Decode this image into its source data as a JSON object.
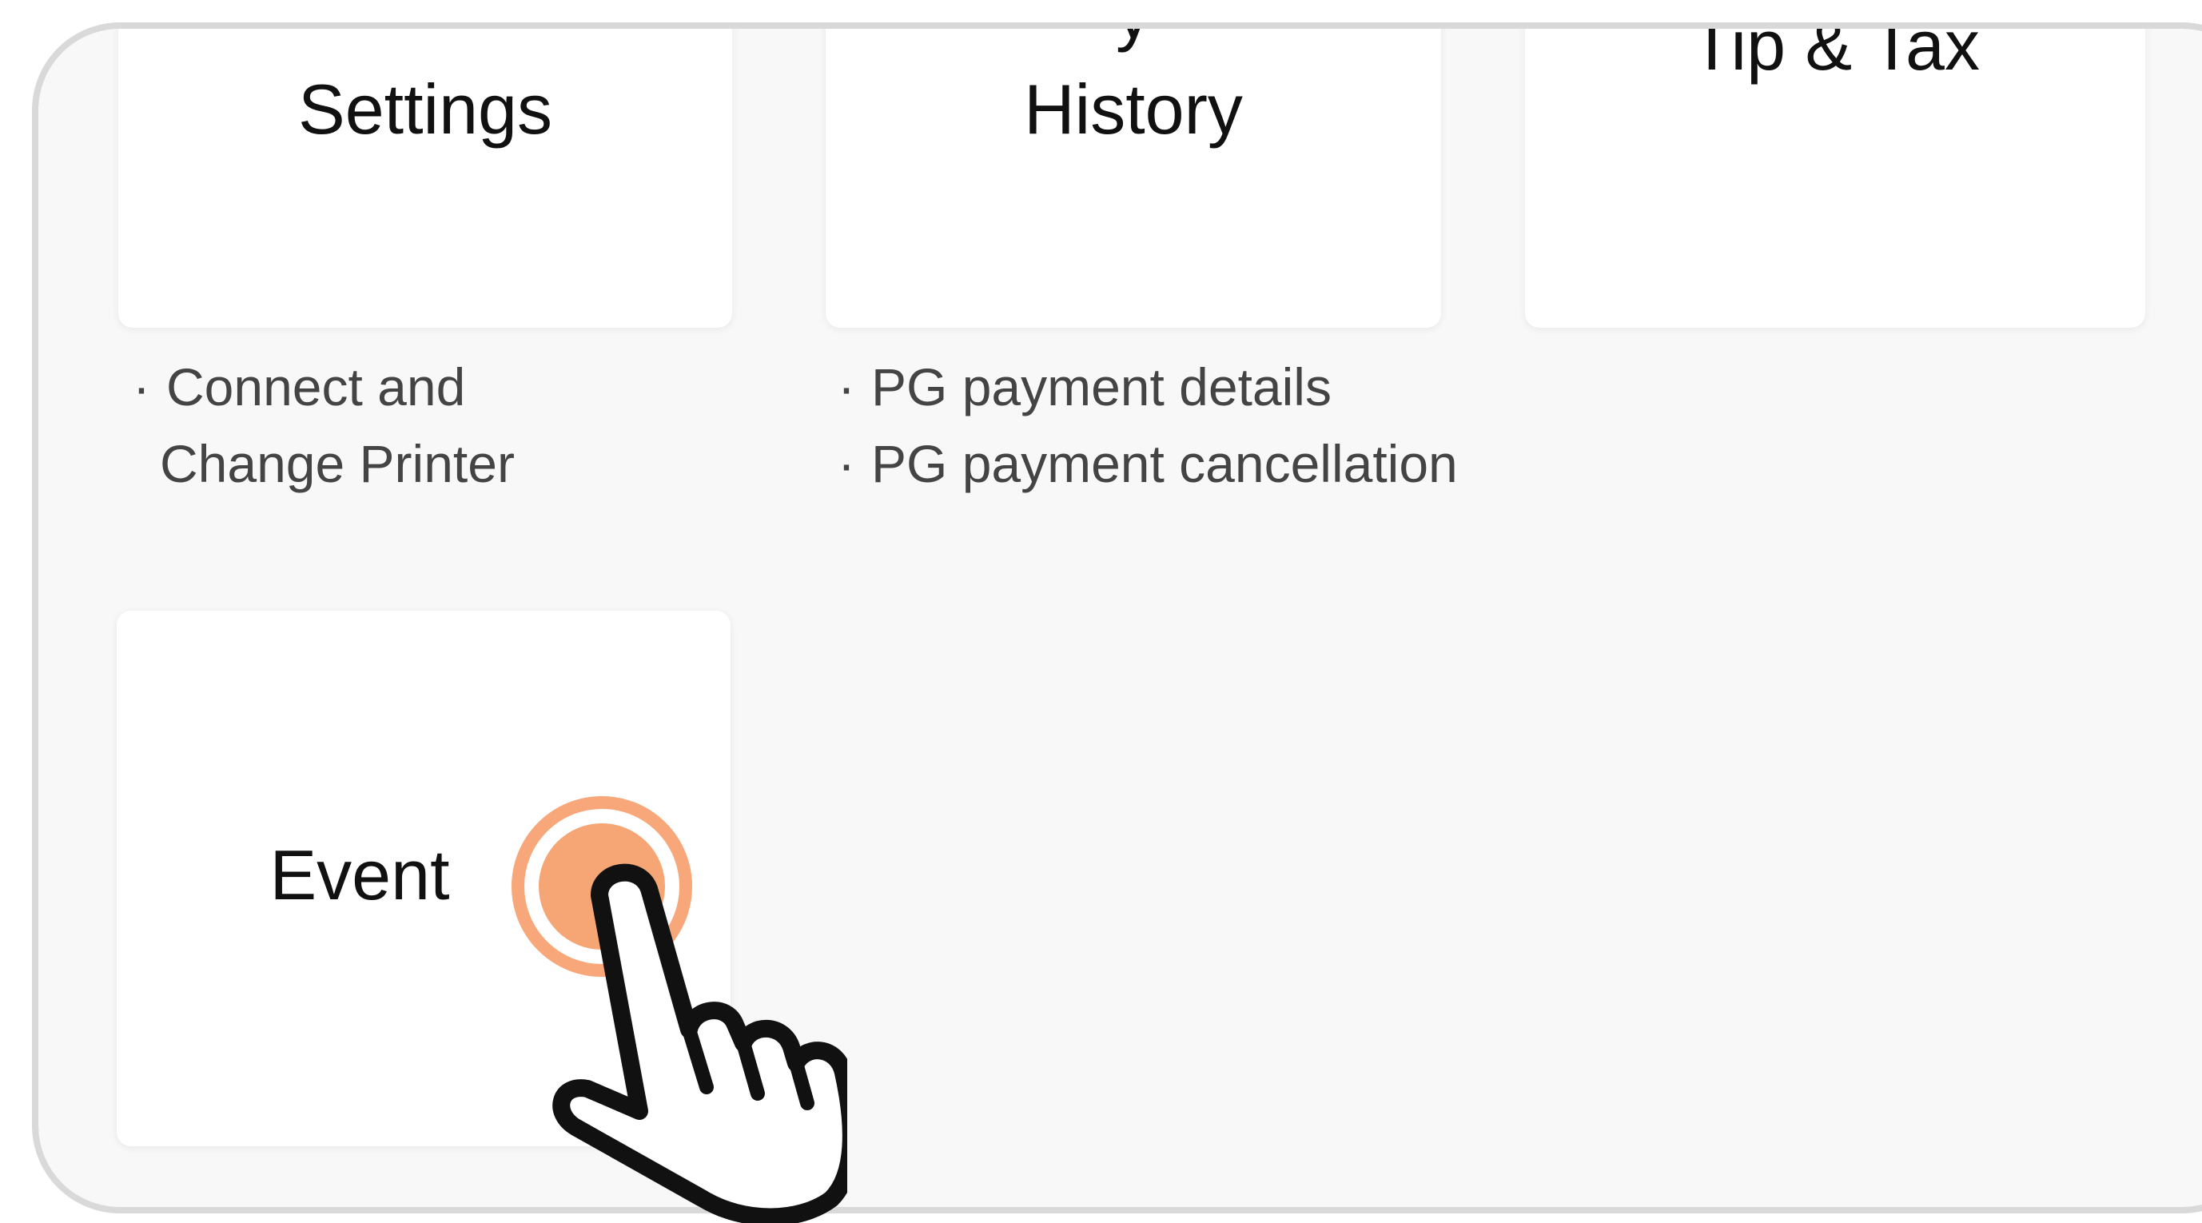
{
  "colors": {
    "panel_background": "#f8f8f8",
    "panel_border": "#d9d9d9",
    "card_background": "#ffffff",
    "tap_accent": "#f6a574"
  },
  "cards": {
    "settings": {
      "title": "Settings"
    },
    "history": {
      "title": "History",
      "cut_text": "y"
    },
    "tip_tax": {
      "title": "Tip & Tax"
    },
    "event": {
      "title": "Event"
    }
  },
  "descriptions": {
    "settings": {
      "bullet": "·",
      "line1": "Connect and",
      "line2": "Change Printer"
    },
    "history": {
      "bullet": "·",
      "item1": "PG payment details",
      "item2": "PG payment cancellation"
    }
  },
  "icons": {
    "tap_indicator": "tap-ripple-icon",
    "pointer": "pointing-hand-icon"
  }
}
